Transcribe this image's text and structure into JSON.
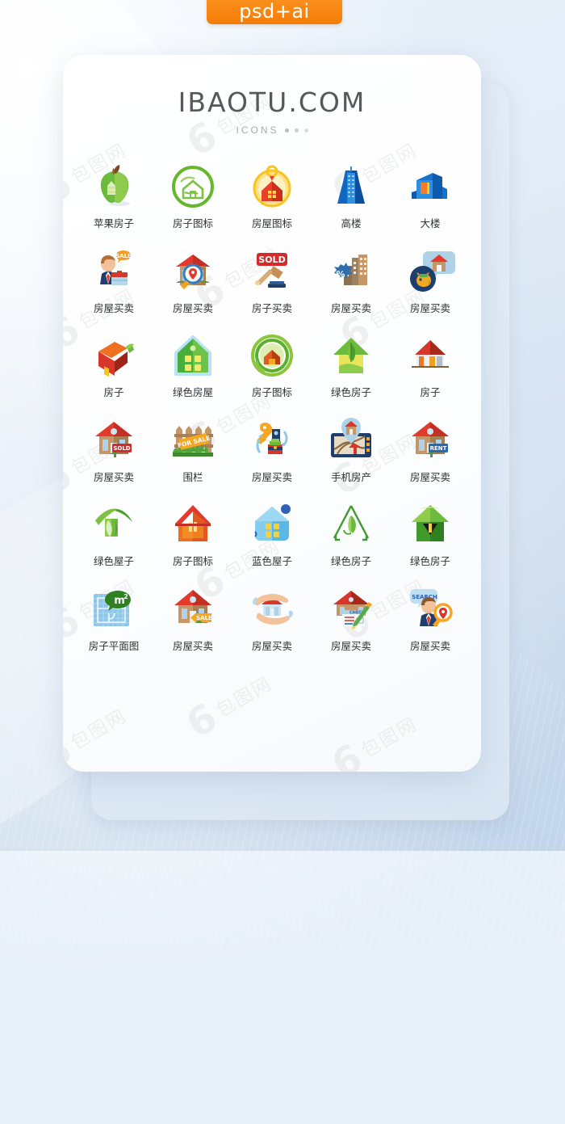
{
  "badge": {
    "label": "psd+ai"
  },
  "header": {
    "title": "IBAOTU.COM",
    "subtitle": "ICONS"
  },
  "watermark": {
    "mark": "6",
    "text": "包图网"
  },
  "colors": {
    "badge_orange": "#f98b18",
    "background_blue": "#d2e0ef",
    "card_white": "#ffffff",
    "title_gray": "#55595c",
    "label_dark": "#2f3133",
    "green": "#5bb431",
    "red": "#d8362a",
    "blue": "#1573c6",
    "gold": "#f7c42a"
  },
  "icons": [
    {
      "id": "apple-house",
      "name": "apple-house-icon",
      "label": "苹果房子"
    },
    {
      "id": "house-circle-green",
      "name": "house-circle-outline-icon",
      "label": "房子图标"
    },
    {
      "id": "house-keyring-gold",
      "name": "house-keyring-icon",
      "label": "房屋图标"
    },
    {
      "id": "skyscraper",
      "name": "skyscraper-icon",
      "label": "高楼"
    },
    {
      "id": "office-building",
      "name": "office-building-icon",
      "label": "大楼"
    },
    {
      "id": "agent-sale",
      "name": "agent-sale-icon",
      "label": "房屋买卖"
    },
    {
      "id": "house-search-pin",
      "name": "house-search-pin-icon",
      "label": "房屋买卖"
    },
    {
      "id": "sold-gavel",
      "name": "sold-gavel-icon",
      "label": "房子买卖"
    },
    {
      "id": "buildings-percent",
      "name": "buildings-discount-icon",
      "label": "房屋买卖"
    },
    {
      "id": "piggy-house",
      "name": "piggy-bank-house-icon",
      "label": "房屋买卖"
    },
    {
      "id": "red-3d-house",
      "name": "red-3d-house-icon",
      "label": "房子"
    },
    {
      "id": "green-house-windows",
      "name": "green-house-icon",
      "label": "绿色房屋"
    },
    {
      "id": "orange-house-ring",
      "name": "house-ring-icon",
      "label": "房子图标"
    },
    {
      "id": "leaf-house",
      "name": "leaf-house-icon",
      "label": "绿色房子"
    },
    {
      "id": "red-roof-house",
      "name": "red-roof-house-icon",
      "label": "房子"
    },
    {
      "id": "house-sold-sign",
      "name": "house-sold-sign-icon",
      "label": "房屋买卖"
    },
    {
      "id": "fence-for-sale",
      "name": "fence-for-sale-icon",
      "label": "围栏"
    },
    {
      "id": "keys-money",
      "name": "keys-money-exchange-icon",
      "label": "房屋买卖"
    },
    {
      "id": "map-pin-house",
      "name": "map-house-pin-icon",
      "label": "手机房产"
    },
    {
      "id": "house-rent-sign",
      "name": "house-rent-sign-icon",
      "label": "房屋买卖"
    },
    {
      "id": "green-leaf-roof",
      "name": "green-leaf-roof-icon",
      "label": "绿色屋子"
    },
    {
      "id": "orange-house-glow",
      "name": "orange-house-icon",
      "label": "房子图标"
    },
    {
      "id": "blue-house-pin",
      "name": "blue-house-icon",
      "label": "蓝色屋子"
    },
    {
      "id": "outline-leaf-house",
      "name": "outline-leaf-house-icon",
      "label": "绿色房子"
    },
    {
      "id": "green-house-arrow",
      "name": "green-house-arrow-icon",
      "label": "绿色房子"
    },
    {
      "id": "floor-plan",
      "name": "floor-plan-icon",
      "label": "房子平面图"
    },
    {
      "id": "house-sale-tag",
      "name": "house-sale-tag-icon",
      "label": "房屋买卖"
    },
    {
      "id": "hand-house",
      "name": "hand-holding-house-icon",
      "label": "房屋买卖"
    },
    {
      "id": "house-contract",
      "name": "house-contract-icon",
      "label": "房屋买卖"
    },
    {
      "id": "agent-search",
      "name": "agent-search-icon",
      "label": "房屋买卖"
    }
  ]
}
